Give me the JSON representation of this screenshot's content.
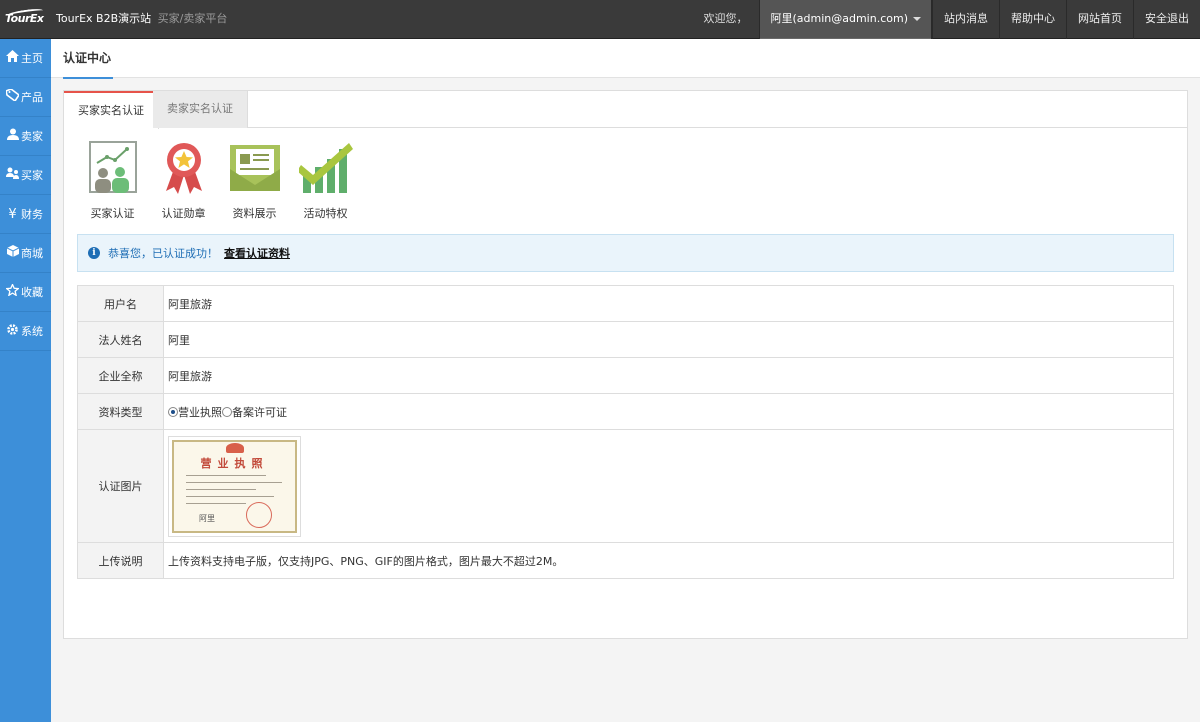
{
  "header": {
    "logo_text": "TourEx",
    "site_name": "TourEx B2B演示站",
    "site_sub": "买家/卖家平台",
    "welcome": "欢迎您，",
    "user": "阿里(admin@admin.com)",
    "links": [
      "站内消息",
      "帮助中心",
      "网站首页",
      "安全退出"
    ]
  },
  "sidebar": {
    "items": [
      {
        "label": "主页",
        "icon": "home-icon"
      },
      {
        "label": "产品",
        "icon": "tag-icon"
      },
      {
        "label": "卖家",
        "icon": "user-icon"
      },
      {
        "label": "买家",
        "icon": "users-icon"
      },
      {
        "label": "财务",
        "icon": "yen-icon"
      },
      {
        "label": "商城",
        "icon": "box-icon"
      },
      {
        "label": "收藏",
        "icon": "star-icon"
      },
      {
        "label": "系统",
        "icon": "gear-icon"
      }
    ]
  },
  "page": {
    "title": "认证中心",
    "tabs": [
      "买家实名认证",
      "卖家实名认证"
    ],
    "features": [
      "买家认证",
      "认证勋章",
      "资料展示",
      "活动特权"
    ],
    "alert": {
      "text": "恭喜您，已认证成功！",
      "link": "查看认证资料"
    },
    "table": {
      "username_label": "用户名",
      "username_value": "阿里旅游",
      "legal_label": "法人姓名",
      "legal_value": "阿里",
      "company_label": "企业全称",
      "company_value": "阿里旅游",
      "type_label": "资料类型",
      "type_options": [
        "营业执照",
        "备案许可证"
      ],
      "type_selected": "营业执照",
      "image_label": "认证图片",
      "license_title": "营业执照",
      "license_sig": "阿里",
      "upload_label": "上传说明",
      "upload_value": "上传资料支持电子版，仅支持JPG、PNG、GIF的图片格式，图片最大不超过2M。"
    }
  },
  "colors": {
    "sidebar": "#3d8fd9",
    "topbar": "#3a3a3a",
    "accent_red": "#e0312c",
    "tab_active_border": "#e6534a",
    "alert_bg": "#eaf4fb"
  }
}
